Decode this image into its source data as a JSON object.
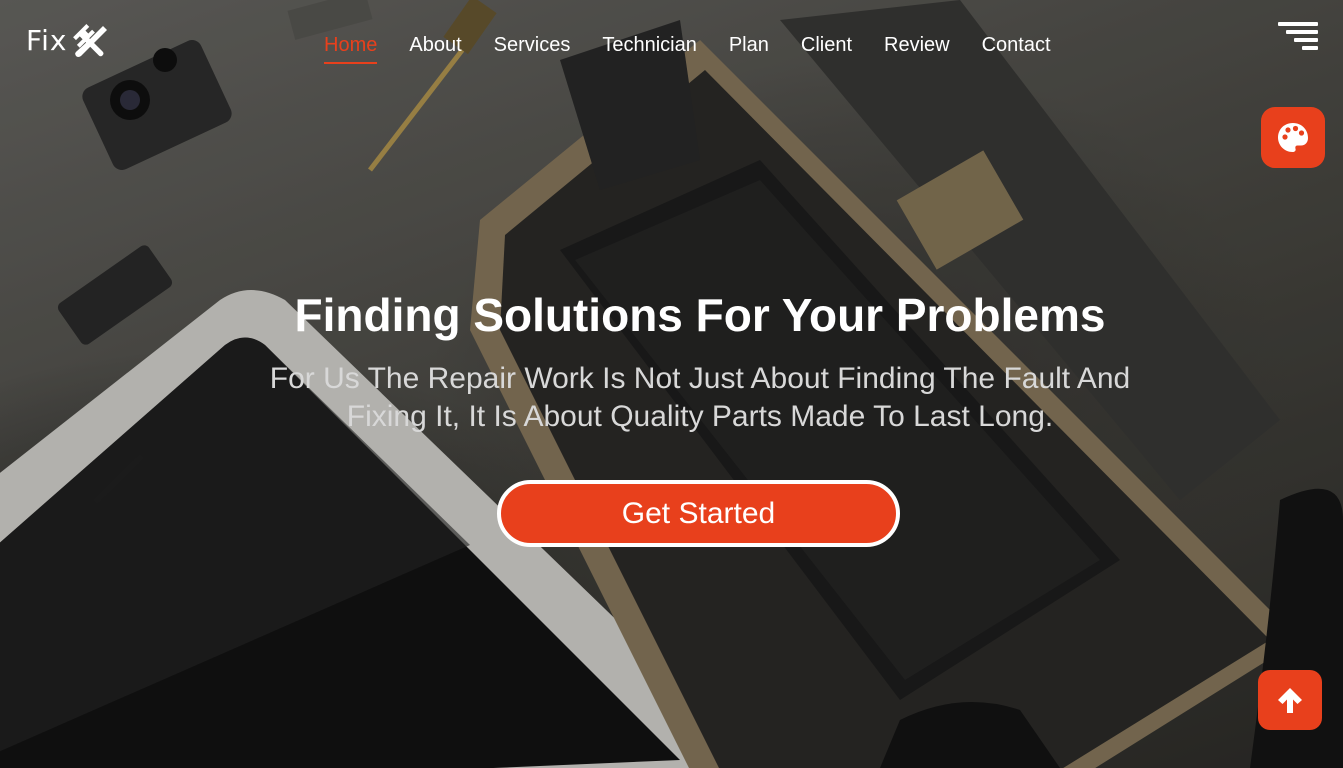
{
  "brand": {
    "name": "Fix",
    "icon": "tools-icon",
    "accent_color": "#e8401c"
  },
  "nav": {
    "items": [
      {
        "label": "Home",
        "active": true
      },
      {
        "label": "About",
        "active": false
      },
      {
        "label": "Services",
        "active": false
      },
      {
        "label": "Technician",
        "active": false
      },
      {
        "label": "Plan",
        "active": false
      },
      {
        "label": "Client",
        "active": false
      },
      {
        "label": "Review",
        "active": false
      },
      {
        "label": "Contact",
        "active": false
      }
    ],
    "menu_icon": "menu-icon"
  },
  "floating": {
    "theme_icon": "palette-icon",
    "scroll_top_icon": "arrow-up-icon"
  },
  "hero": {
    "title": "Finding Solutions For Your Problems",
    "subtitle": "For Us The Repair Work Is Not Just About Finding The Fault And Fixing It, It Is About Quality Parts Made To Last Long.",
    "cta_label": "Get Started",
    "background": "disassembled-phone-photo"
  }
}
